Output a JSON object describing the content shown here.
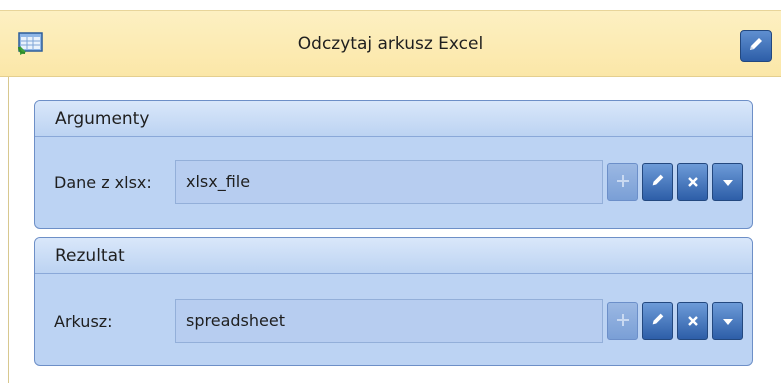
{
  "header": {
    "title": "Odczytaj arkusz Excel",
    "app_icon": "spreadsheet-import-icon",
    "edit_icon": "pencil-icon"
  },
  "arguments": {
    "title": "Argumenty",
    "field": {
      "label": "Dane z xlsx:",
      "value": "xlsx_file"
    }
  },
  "result": {
    "title": "Rezultat",
    "field": {
      "label": "Arkusz:",
      "value": "spreadsheet"
    }
  },
  "field_buttons": [
    "plus-icon",
    "pencil-icon",
    "close-icon",
    "dropdown-arrow-icon"
  ],
  "colors": {
    "header_bg": "#fbe7a8",
    "panel_bg": "#bcd3f3",
    "button_blue": "#2d5ea8"
  }
}
